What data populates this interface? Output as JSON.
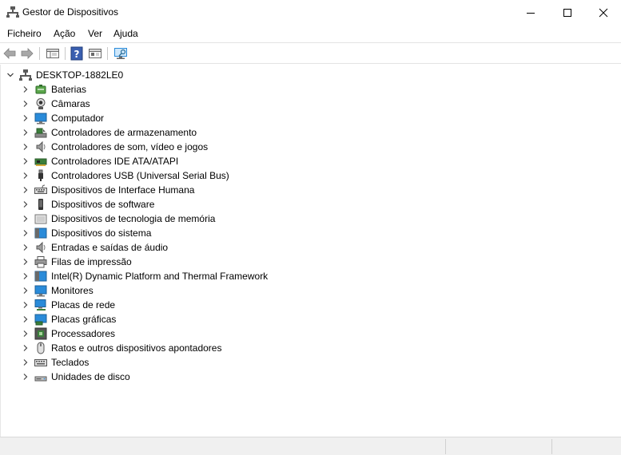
{
  "window": {
    "title": "Gestor de Dispositivos"
  },
  "menu": [
    "Ficheiro",
    "Ação",
    "Ver",
    "Ajuda"
  ],
  "tree": {
    "root": "DESKTOP-1882LE0",
    "items": [
      {
        "label": "Baterias",
        "icon": "battery-icon"
      },
      {
        "label": "Câmaras",
        "icon": "camera-icon"
      },
      {
        "label": "Computador",
        "icon": "monitor-icon"
      },
      {
        "label": "Controladores de armazenamento",
        "icon": "storage-controller-icon"
      },
      {
        "label": "Controladores de som, vídeo e jogos",
        "icon": "speaker-icon"
      },
      {
        "label": "Controladores IDE ATA/ATAPI",
        "icon": "ide-card-icon"
      },
      {
        "label": "Controladores USB (Universal Serial Bus)",
        "icon": "usb-icon"
      },
      {
        "label": "Dispositivos de Interface Humana",
        "icon": "keyboard-hid-icon"
      },
      {
        "label": "Dispositivos de software",
        "icon": "software-device-icon"
      },
      {
        "label": "Dispositivos de tecnologia de memória",
        "icon": "memory-device-icon"
      },
      {
        "label": "Dispositivos do sistema",
        "icon": "system-folder-icon"
      },
      {
        "label": "Entradas e saídas de áudio",
        "icon": "speaker-icon"
      },
      {
        "label": "Filas de impressão",
        "icon": "printer-icon"
      },
      {
        "label": "Intel(R) Dynamic Platform and Thermal Framework",
        "icon": "system-folder-icon"
      },
      {
        "label": "Monitores",
        "icon": "monitor-icon"
      },
      {
        "label": "Placas de rede",
        "icon": "network-adapter-icon"
      },
      {
        "label": "Placas gráficas",
        "icon": "display-adapter-icon"
      },
      {
        "label": "Processadores",
        "icon": "processor-icon"
      },
      {
        "label": "Ratos e outros dispositivos apontadores",
        "icon": "mouse-icon"
      },
      {
        "label": "Teclados",
        "icon": "keyboard-icon"
      },
      {
        "label": "Unidades de disco",
        "icon": "disk-drive-icon"
      }
    ]
  },
  "colors": {
    "accent": "#0078d7",
    "monitor": "#2a8bd9",
    "chip_green": "#3b7f3b"
  }
}
